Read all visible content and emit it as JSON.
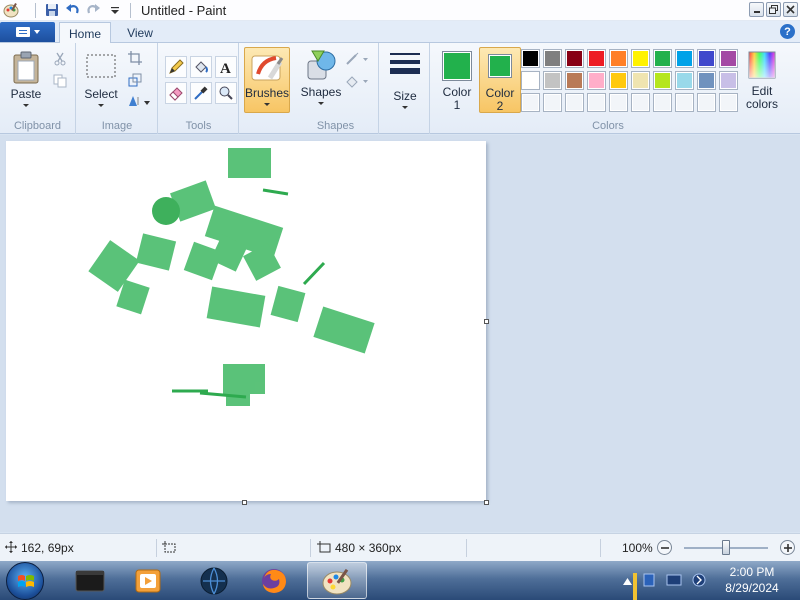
{
  "window": {
    "title": "Untitled - Paint"
  },
  "ribbon": {
    "tabs": [
      {
        "label": "Home"
      },
      {
        "label": "View"
      }
    ],
    "help_label": "?",
    "groups": {
      "clipboard": {
        "label": "Clipboard",
        "paste_label": "Paste"
      },
      "image": {
        "label": "Image",
        "select_label": "Select"
      },
      "tools": {
        "label": "Tools"
      },
      "brushes": {
        "label": "Brushes"
      },
      "shapes": {
        "label": "Shapes",
        "shapes_label": "Shapes"
      },
      "size": {
        "label": "Size"
      },
      "colors": {
        "label": "Colors",
        "color1_label": "Color",
        "color1_num": "1",
        "color2_label": "Color",
        "color2_num": "2",
        "edit_label": "Edit",
        "edit_label2": "colors",
        "color1": "#22b14c",
        "color2": "#22b14c",
        "palette": [
          "#000000",
          "#7f7f7f",
          "#880015",
          "#ed1c24",
          "#ff7f27",
          "#fff200",
          "#22b14c",
          "#00a2e8",
          "#3f48cc",
          "#a349a4",
          "#ffffff",
          "#c3c3c3",
          "#b97a57",
          "#ffaec9",
          "#ffc90e",
          "#efe4b0",
          "#b5e61d",
          "#99d9ea",
          "#7092be",
          "#c8bfe7",
          "#ffffff",
          "#ffffff",
          "#ffffff",
          "#ffffff",
          "#ffffff",
          "#ffffff",
          "#ffffff",
          "#ffffff",
          "#ffffff",
          "#ffffff"
        ]
      }
    }
  },
  "canvas": {
    "fill_color": "#4dbd6e"
  },
  "statusbar": {
    "cursor_position": "162, 69px",
    "canvas_size": "480 × 360px",
    "zoom": "100%"
  },
  "taskbar": {
    "time": "2:00 PM",
    "date": "8/29/2024"
  }
}
